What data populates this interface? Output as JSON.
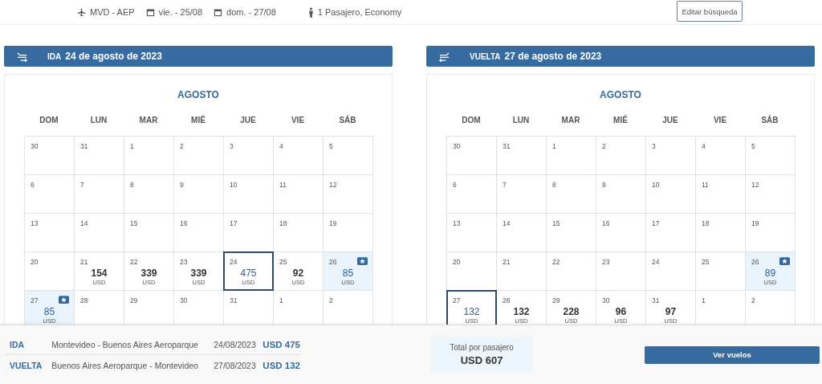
{
  "search_summary": {
    "items": [
      {
        "kind": "plane",
        "text": "MVD - AEP"
      },
      {
        "kind": "calendar",
        "text": "vie. - 25/08"
      },
      {
        "kind": "calendar",
        "text": "dom. - 27/08"
      },
      {
        "kind": "person",
        "text": "1 Pasajero, Economy"
      }
    ],
    "edit_button": "Editar búsqueda"
  },
  "legs": [
    {
      "kind": "outbound",
      "label": "IDA",
      "date": "24 de agosto de 2023",
      "month": "AGOSTO",
      "weekdays": [
        "DOM",
        "LUN",
        "MAR",
        "MIÉ",
        "JUE",
        "VIE",
        "SÁB"
      ],
      "weeks": [
        [
          {
            "day": "30",
            "selected": false,
            "best": false
          },
          {
            "day": "31",
            "selected": false,
            "best": false
          },
          {
            "day": "1",
            "selected": false,
            "best": false
          },
          {
            "day": "2",
            "selected": false,
            "best": false
          },
          {
            "day": "3",
            "selected": false,
            "best": false
          },
          {
            "day": "4",
            "selected": false,
            "best": false
          },
          {
            "day": "5",
            "selected": false,
            "best": false
          }
        ],
        [
          {
            "day": "6",
            "selected": false,
            "best": false
          },
          {
            "day": "7",
            "selected": false,
            "best": false
          },
          {
            "day": "8",
            "selected": false,
            "best": false
          },
          {
            "day": "9",
            "selected": false,
            "best": false
          },
          {
            "day": "10",
            "selected": false,
            "best": false
          },
          {
            "day": "11",
            "selected": false,
            "best": false
          },
          {
            "day": "12",
            "selected": false,
            "best": false
          }
        ],
        [
          {
            "day": "13",
            "selected": false,
            "best": false
          },
          {
            "day": "14",
            "selected": false,
            "best": false
          },
          {
            "day": "15",
            "selected": false,
            "best": false
          },
          {
            "day": "16",
            "selected": false,
            "best": false
          },
          {
            "day": "17",
            "selected": false,
            "best": false
          },
          {
            "day": "18",
            "selected": false,
            "best": false
          },
          {
            "day": "19",
            "selected": false,
            "best": false
          }
        ],
        [
          {
            "day": "20",
            "selected": false,
            "best": false
          },
          {
            "day": "21",
            "price": "154",
            "currency": "USD",
            "selected": false,
            "best": false
          },
          {
            "day": "22",
            "price": "339",
            "currency": "USD",
            "selected": false,
            "best": false
          },
          {
            "day": "23",
            "price": "339",
            "currency": "USD",
            "selected": false,
            "best": false
          },
          {
            "day": "24",
            "price": "475",
            "currency": "USD",
            "selected": true,
            "best": false
          },
          {
            "day": "25",
            "price": "92",
            "currency": "USD",
            "selected": false,
            "best": false
          },
          {
            "day": "26",
            "price": "85",
            "currency": "USD",
            "selected": false,
            "best": true
          }
        ],
        [
          {
            "day": "27",
            "price": "85",
            "currency": "USD",
            "selected": false,
            "best": true
          },
          {
            "day": "28",
            "selected": false,
            "best": false
          },
          {
            "day": "29",
            "selected": false,
            "best": false
          },
          {
            "day": "30",
            "selected": false,
            "best": false
          },
          {
            "day": "31",
            "selected": false,
            "best": false
          },
          {
            "day": "1",
            "selected": false,
            "best": false
          },
          {
            "day": "2",
            "selected": false,
            "best": false
          }
        ]
      ]
    },
    {
      "kind": "return",
      "label": "VUELTA",
      "date": "27 de agosto de 2023",
      "month": "AGOSTO",
      "weekdays": [
        "DOM",
        "LUN",
        "MAR",
        "MIÉ",
        "JUE",
        "VIE",
        "SÁB"
      ],
      "weeks": [
        [
          {
            "day": "30",
            "selected": false,
            "best": false
          },
          {
            "day": "31",
            "selected": false,
            "best": false
          },
          {
            "day": "1",
            "selected": false,
            "best": false
          },
          {
            "day": "2",
            "selected": false,
            "best": false
          },
          {
            "day": "3",
            "selected": false,
            "best": false
          },
          {
            "day": "4",
            "selected": false,
            "best": false
          },
          {
            "day": "5",
            "selected": false,
            "best": false
          }
        ],
        [
          {
            "day": "6",
            "selected": false,
            "best": false
          },
          {
            "day": "7",
            "selected": false,
            "best": false
          },
          {
            "day": "8",
            "selected": false,
            "best": false
          },
          {
            "day": "9",
            "selected": false,
            "best": false
          },
          {
            "day": "10",
            "selected": false,
            "best": false
          },
          {
            "day": "11",
            "selected": false,
            "best": false
          },
          {
            "day": "12",
            "selected": false,
            "best": false
          }
        ],
        [
          {
            "day": "13",
            "selected": false,
            "best": false
          },
          {
            "day": "14",
            "selected": false,
            "best": false
          },
          {
            "day": "15",
            "selected": false,
            "best": false
          },
          {
            "day": "16",
            "selected": false,
            "best": false
          },
          {
            "day": "17",
            "selected": false,
            "best": false
          },
          {
            "day": "18",
            "selected": false,
            "best": false
          },
          {
            "day": "19",
            "selected": false,
            "best": false
          }
        ],
        [
          {
            "day": "20",
            "selected": false,
            "best": false
          },
          {
            "day": "21",
            "selected": false,
            "best": false
          },
          {
            "day": "22",
            "selected": false,
            "best": false
          },
          {
            "day": "23",
            "selected": false,
            "best": false
          },
          {
            "day": "24",
            "selected": false,
            "best": false
          },
          {
            "day": "25",
            "selected": false,
            "best": false
          },
          {
            "day": "26",
            "price": "89",
            "currency": "USD",
            "selected": false,
            "best": true
          }
        ],
        [
          {
            "day": "27",
            "price": "132",
            "currency": "USD",
            "selected": true,
            "best": false
          },
          {
            "day": "28",
            "price": "132",
            "currency": "USD",
            "selected": false,
            "best": false
          },
          {
            "day": "29",
            "price": "228",
            "currency": "USD",
            "selected": false,
            "best": false
          },
          {
            "day": "30",
            "price": "96",
            "currency": "USD",
            "selected": false,
            "best": false
          },
          {
            "day": "31",
            "price": "97",
            "currency": "USD",
            "selected": false,
            "best": false
          },
          {
            "day": "1",
            "selected": false,
            "best": false
          },
          {
            "day": "2",
            "selected": false,
            "best": false
          }
        ]
      ]
    }
  ],
  "summary": {
    "rows": [
      {
        "label": "IDA",
        "route": "Montevideo - Buenos Aires Aeroparque",
        "date": "24/08/2023",
        "price": "USD 475"
      },
      {
        "label": "VUELTA",
        "route": "Buenos Aires Aeroparque - Montevideo",
        "date": "27/08/2023",
        "price": "USD 132"
      }
    ],
    "total_label": "Total por pasajero",
    "total": "USD 607",
    "button": "Ver vuelos"
  }
}
